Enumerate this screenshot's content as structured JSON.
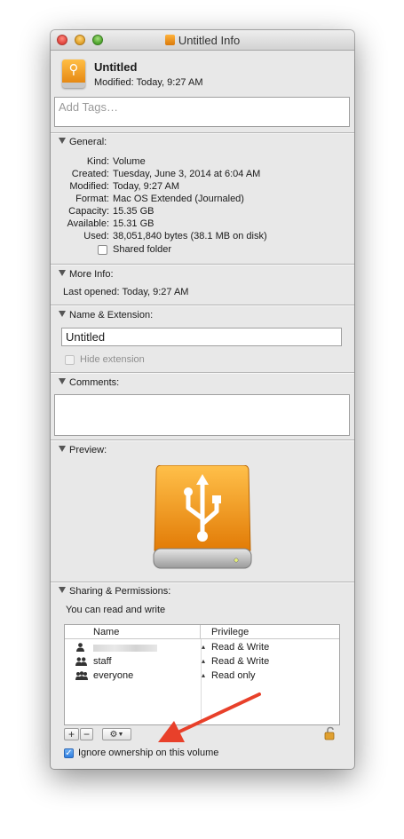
{
  "window": {
    "title": "Untitled Info"
  },
  "header": {
    "name": "Untitled",
    "modified": "Modified: Today, 9:27 AM",
    "tags_placeholder": "Add Tags…"
  },
  "general": {
    "heading": "General:",
    "rows": [
      {
        "key": "Kind:",
        "value": "Volume"
      },
      {
        "key": "Created:",
        "value": "Tuesday, June 3, 2014 at 6:04 AM"
      },
      {
        "key": "Modified:",
        "value": "Today, 9:27 AM"
      },
      {
        "key": "Format:",
        "value": "Mac OS Extended (Journaled)"
      },
      {
        "key": "Capacity:",
        "value": "15.35 GB"
      },
      {
        "key": "Available:",
        "value": "15.31 GB"
      },
      {
        "key": "Used:",
        "value": "38,051,840 bytes (38.1 MB on disk)"
      }
    ],
    "shared_folder_label": "Shared folder"
  },
  "more_info": {
    "heading": "More Info:",
    "last_opened": "Last opened: Today, 9:27 AM"
  },
  "name_ext": {
    "heading": "Name & Extension:",
    "name_value": "Untitled",
    "hide_extension_label": "Hide extension"
  },
  "comments": {
    "heading": "Comments:",
    "value": ""
  },
  "preview": {
    "heading": "Preview:"
  },
  "sharing": {
    "heading": "Sharing & Permissions:",
    "summary": "You can read and write",
    "columns": {
      "name": "Name",
      "privilege": "Privilege"
    },
    "rows": [
      {
        "name": "",
        "privilege": "Read & Write"
      },
      {
        "name": "staff",
        "privilege": "Read & Write"
      },
      {
        "name": "everyone",
        "privilege": "Read only"
      }
    ],
    "add_label": "+",
    "remove_label": "−",
    "ignore_ownership_label": "Ignore ownership on this volume"
  },
  "colors": {
    "accent_orange": "#f29a1a",
    "annotation_arrow": "#e8402a",
    "check_blue": "#2f7fe0"
  }
}
